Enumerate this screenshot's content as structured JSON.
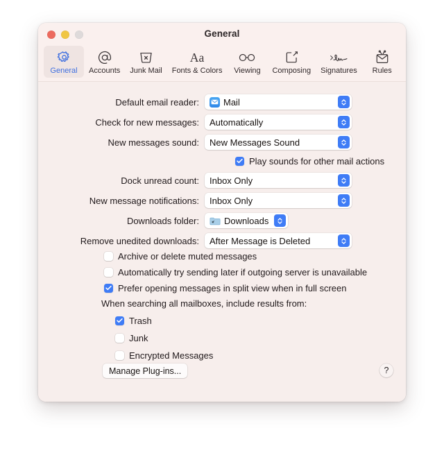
{
  "window": {
    "title": "General",
    "traffic_lights": [
      "close",
      "minimize",
      "zoom"
    ]
  },
  "toolbar": {
    "tabs": [
      {
        "label": "General",
        "icon": "gear-icon",
        "selected": true
      },
      {
        "label": "Accounts",
        "icon": "at-sign-icon",
        "selected": false
      },
      {
        "label": "Junk Mail",
        "icon": "junk-bin-icon",
        "selected": false
      },
      {
        "label": "Fonts & Colors",
        "icon": "font-aa-icon",
        "selected": false
      },
      {
        "label": "Viewing",
        "icon": "glasses-icon",
        "selected": false
      },
      {
        "label": "Composing",
        "icon": "compose-pencil-icon",
        "selected": false
      },
      {
        "label": "Signatures",
        "icon": "signature-icon",
        "selected": false
      },
      {
        "label": "Rules",
        "icon": "rules-envelope-icon",
        "selected": false
      }
    ]
  },
  "form": {
    "rows": [
      {
        "label": "Default email reader:",
        "value": "Mail",
        "icon": "mail-app-icon",
        "width": "wide"
      },
      {
        "label": "Check for new messages:",
        "value": "Automatically",
        "icon": null,
        "width": "wide"
      },
      {
        "label": "New messages sound:",
        "value": "New Messages Sound",
        "icon": null,
        "width": "wide"
      },
      {
        "label": "Dock unread count:",
        "value": "Inbox Only",
        "icon": null,
        "width": "wide"
      },
      {
        "label": "New message notifications:",
        "value": "Inbox Only",
        "icon": null,
        "width": "wide"
      },
      {
        "label": "Downloads folder:",
        "value": "Downloads",
        "icon": "folder-icon",
        "width": "fit"
      },
      {
        "label": "Remove unedited downloads:",
        "value": "After Message is Deleted",
        "icon": null,
        "width": "wide"
      }
    ],
    "play_sounds": {
      "label": "Play sounds for other mail actions",
      "checked": true
    }
  },
  "options": [
    {
      "label": "Archive or delete muted messages",
      "checked": false
    },
    {
      "label": "Automatically try sending later if outgoing server is unavailable",
      "checked": false
    },
    {
      "label": "Prefer opening messages in split view when in full screen",
      "checked": true
    }
  ],
  "search_scope": {
    "heading": "When searching all mailboxes, include results from:",
    "items": [
      {
        "label": "Trash",
        "checked": true
      },
      {
        "label": "Junk",
        "checked": false
      },
      {
        "label": "Encrypted Messages",
        "checked": false
      }
    ]
  },
  "footer": {
    "manage_plugins_label": "Manage Plug-ins...",
    "help_label": "?"
  },
  "colors": {
    "window_background": "#f7eeec",
    "toolbar_background": "#faf0ee",
    "accent": "#3f7cf6",
    "selected_tab_text": "#3f6fe0",
    "text": "#20191b",
    "traffic_red": "#ec6a5e",
    "traffic_yellow": "#f0c644",
    "traffic_gray": "#dedada"
  }
}
